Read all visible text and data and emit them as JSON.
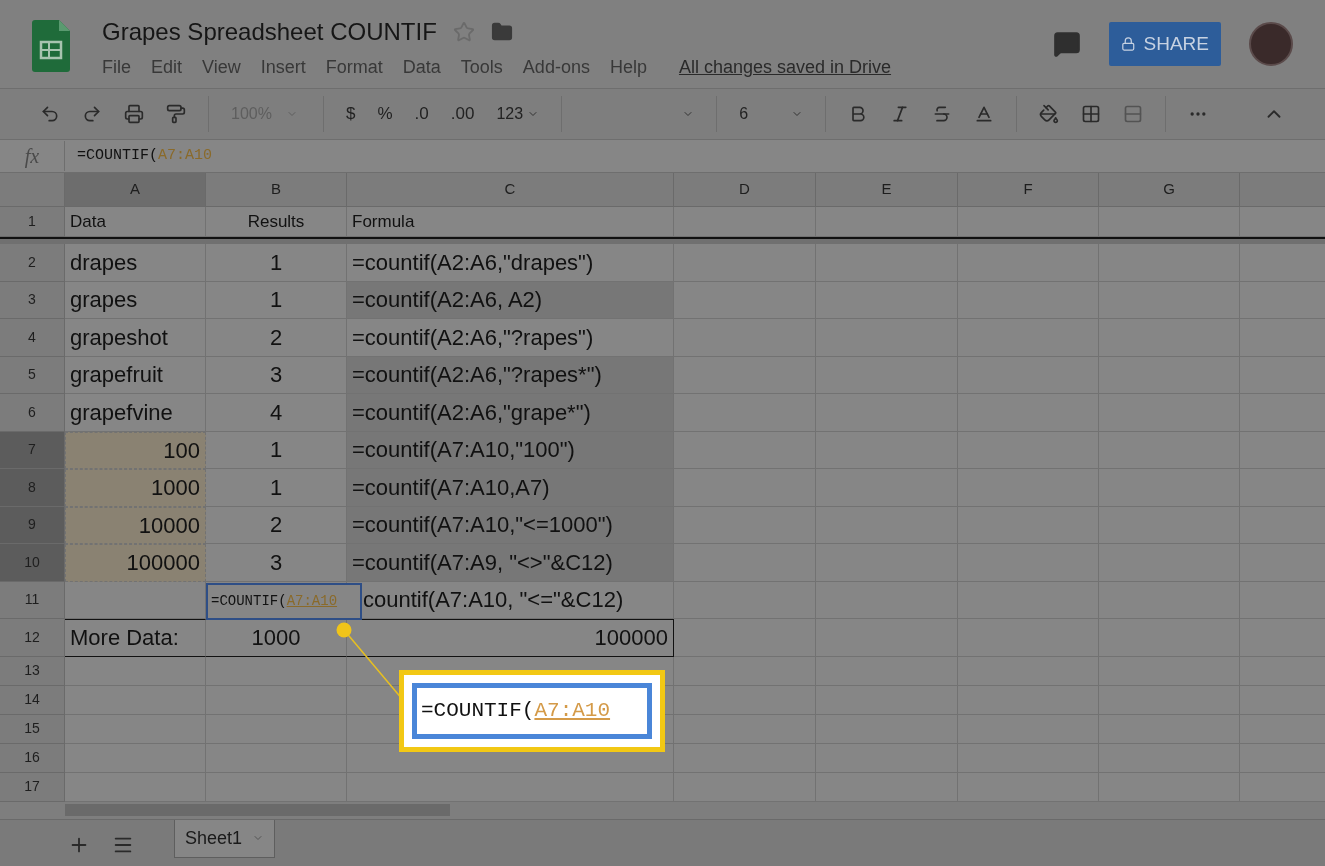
{
  "header": {
    "title": "Grapes Spreadsheet COUNTIF",
    "menu": [
      "File",
      "Edit",
      "View",
      "Insert",
      "Format",
      "Data",
      "Tools",
      "Add-ons",
      "Help"
    ],
    "save_status": "All changes saved in Drive",
    "share": "SHARE"
  },
  "toolbar": {
    "zoom": "100%",
    "currency": "$",
    "percent": "%",
    "decrease_decimals": ".0",
    "increase_decimals": ".00",
    "number_format": "123",
    "font_size": "6"
  },
  "formula_bar": {
    "label": "fx",
    "prefix": "=COUNTIF(",
    "reference": "A7:A10"
  },
  "columns": [
    {
      "label": "A",
      "selected": true
    },
    {
      "label": "B",
      "selected": false
    },
    {
      "label": "C",
      "selected": false
    },
    {
      "label": "D",
      "selected": false
    },
    {
      "label": "E",
      "selected": false
    },
    {
      "label": "F",
      "selected": false
    },
    {
      "label": "G",
      "selected": false
    }
  ],
  "rows": [
    {
      "number": "1",
      "in_range": false,
      "a": "Data",
      "b": "Results",
      "c": "Formula",
      "c_shaded": false
    },
    {
      "number": "2",
      "in_range": false,
      "a": "drapes",
      "b": "1",
      "c": "=countif(A2:A6,\"drapes\")",
      "c_shaded": false
    },
    {
      "number": "3",
      "in_range": false,
      "a": "grapes",
      "b": "1",
      "c": "=countif(A2:A6, A2)",
      "c_shaded": true
    },
    {
      "number": "4",
      "in_range": false,
      "a": "grapeshot",
      "b": "2",
      "c": "=countif(A2:A6,\"?rapes\")",
      "c_shaded": false
    },
    {
      "number": "5",
      "in_range": false,
      "a": "grapefruit",
      "b": "3",
      "c": "=countif(A2:A6,\"?rapes*\")",
      "c_shaded": true
    },
    {
      "number": "6",
      "in_range": false,
      "a": "grapefvine",
      "b": "4",
      "c": "=countif(A2:A6,\"grape*\")",
      "c_shaded": true
    },
    {
      "number": "7",
      "in_range": true,
      "a": "100",
      "b": "1",
      "c": "=countif(A7:A10,\"100\")",
      "c_shaded": true
    },
    {
      "number": "8",
      "in_range": true,
      "a": "1000",
      "b": "1",
      "c": "=countif(A7:A10,A7)",
      "c_shaded": true
    },
    {
      "number": "9",
      "in_range": true,
      "a": "10000",
      "b": "2",
      "c": "=countif(A7:A10,\"<=1000\")",
      "c_shaded": true
    },
    {
      "number": "10",
      "in_range": true,
      "a": "100000",
      "b": "3",
      "c": "=countif(A7:A9, \"<>\"&C12)",
      "c_shaded": true
    },
    {
      "number": "11",
      "in_range": false,
      "c": "countif(A7:A10, \"<=\"&C12)",
      "c_shaded": false
    },
    {
      "number": "12",
      "in_range": false,
      "a": "More Data:",
      "b": "1000",
      "c": "100000",
      "c_shaded": false
    },
    {
      "number": "13",
      "in_range": false
    },
    {
      "number": "14",
      "in_range": false
    },
    {
      "number": "15",
      "in_range": false
    },
    {
      "number": "16",
      "in_range": false
    },
    {
      "number": "17",
      "in_range": false
    }
  ],
  "cell_editor": {
    "prefix": "=COUNTIF(",
    "reference": "A7:A10"
  },
  "callout": {
    "prefix": "=COUNTIF(",
    "reference": "A7:A10"
  },
  "sheets": [
    {
      "label": "Sheet1",
      "selected": true
    }
  ]
}
